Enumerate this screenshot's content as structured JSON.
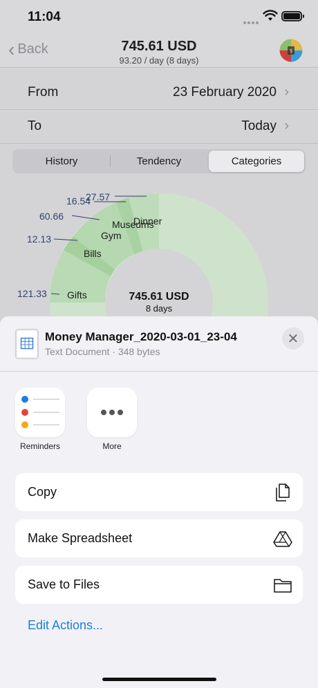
{
  "status_bar": {
    "time": "11:04"
  },
  "nav": {
    "back_label": "Back",
    "title": "745.61 USD",
    "subtitle": "93.20 / day (8 days)"
  },
  "date_range": {
    "from_label": "From",
    "from_value": "23 February 2020",
    "to_label": "To",
    "to_value": "Today"
  },
  "segments": [
    "History",
    "Tendency",
    "Categories"
  ],
  "segments_active": "Categories",
  "chart": {
    "center_total": "745.61 USD",
    "center_days": "8 days",
    "slices": [
      {
        "label": "Dinner",
        "value": "27.57"
      },
      {
        "label": "Museums",
        "value": "16.54"
      },
      {
        "label": "Gym",
        "value": "60.66"
      },
      {
        "label": "Bills",
        "value": "12.13"
      },
      {
        "label": "Gifts",
        "value": "121.33"
      }
    ],
    "colors": {
      "accent_green": "#a9d3a4",
      "light_green": "#c6e1c2"
    }
  },
  "share_sheet": {
    "file_name": "Money Manager_2020-03-01_23-04",
    "file_meta": "Text Document · 348 bytes",
    "apps": [
      {
        "label": "Reminders",
        "icon": "reminders-icon"
      },
      {
        "label": "More",
        "icon": "more-icon"
      }
    ],
    "actions": [
      {
        "label": "Copy",
        "icon": "copy-icon"
      },
      {
        "label": "Make Spreadsheet",
        "icon": "spreadsheet-icon"
      },
      {
        "label": "Save to Files",
        "icon": "folder-icon"
      }
    ],
    "edit_actions_label": "Edit Actions..."
  }
}
